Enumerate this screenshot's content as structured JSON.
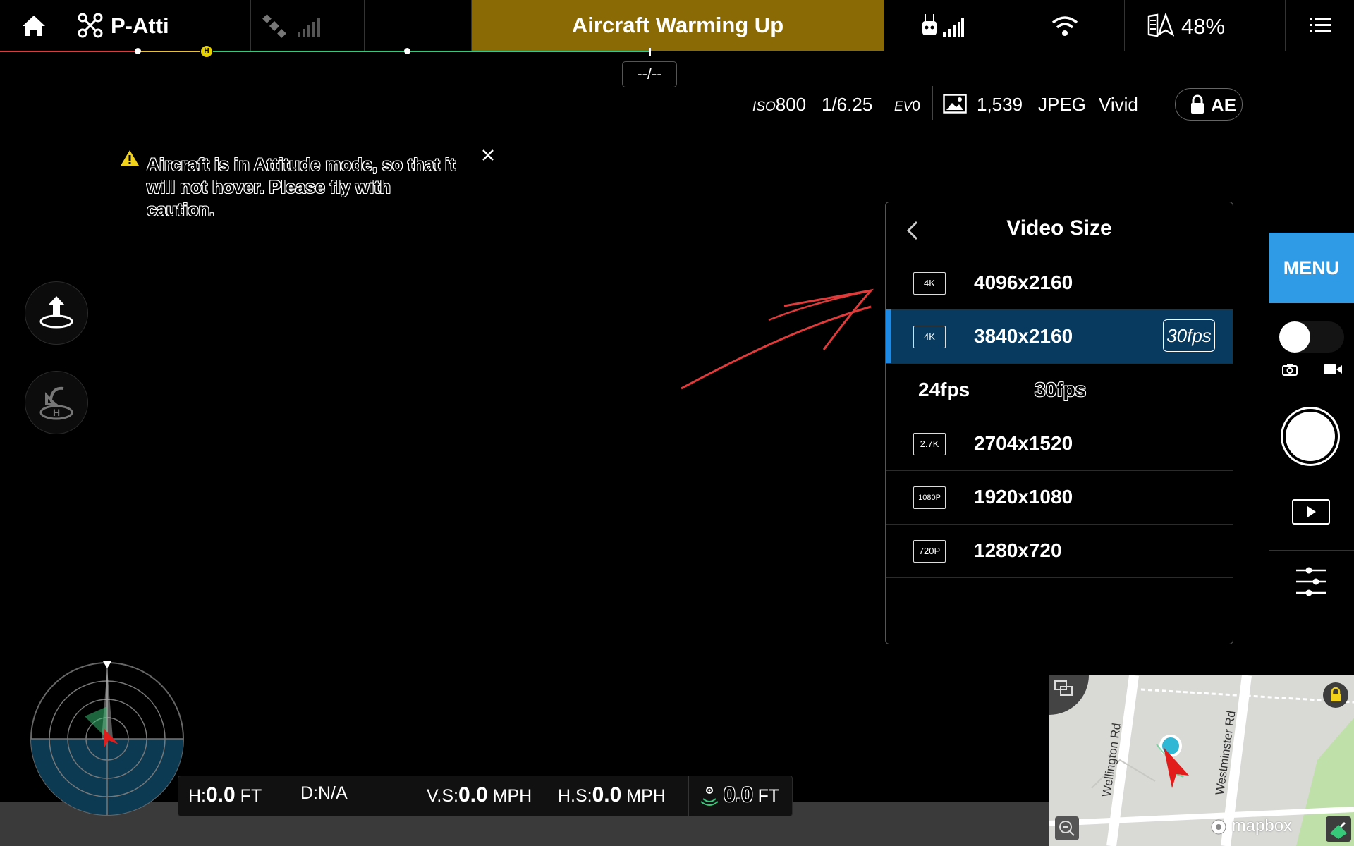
{
  "top_bar": {
    "home_icon": "home-icon",
    "flight_mode": "P-Atti",
    "status_banner": "Aircraft Warming Up",
    "battery": "48%",
    "distance_label": "--/--",
    "colors": {
      "banner": "#8a6a05",
      "line_red": "#e03b3b",
      "line_yellow": "#e8c13a",
      "line_green": "#37c97a"
    }
  },
  "camera": {
    "iso_label": "ISO",
    "iso_value": "800",
    "shutter": "1/6.25",
    "ev_label": "EV",
    "ev_value": "0",
    "capacity": "1,539",
    "format": "JPEG",
    "style": "Vivid",
    "ae_label": "AE"
  },
  "warning": {
    "text": "Aircraft is in Attitude mode, so that it will not hover. Please fly with caution."
  },
  "video_size_panel": {
    "title": "Video Size",
    "rows": [
      {
        "badge": "4K",
        "label": "4096x2160"
      },
      {
        "badge": "4K",
        "label": "3840x2160",
        "fps": "30fps",
        "selected": true
      },
      {
        "badge": "2.7K",
        "label": "2704x1520"
      },
      {
        "badge": "1080P",
        "label": "1920x1080"
      },
      {
        "badge": "720P",
        "label": "1280x720"
      }
    ],
    "fps_options": [
      "24fps",
      "30fps"
    ],
    "colors": {
      "selected_bg": "#073a5e",
      "selected_bar": "#1e8ae6"
    }
  },
  "right_rail": {
    "menu_label": "MENU",
    "accent": "#2f9ae6"
  },
  "telemetry": {
    "h_label": "H:",
    "h_value": "0.0",
    "h_unit": "FT",
    "d_label": "D:",
    "d_value": "N/A",
    "vs_label": "V.S:",
    "vs_value": "0.0",
    "vs_unit": "MPH",
    "hs_label": "H.S:",
    "hs_value": "0.0",
    "hs_unit": "MPH",
    "vps_value": "0.0",
    "vps_unit": "FT"
  },
  "map": {
    "road1": "Wellington Rd",
    "road2": "Westminster Rd",
    "brand": "mapbox"
  }
}
